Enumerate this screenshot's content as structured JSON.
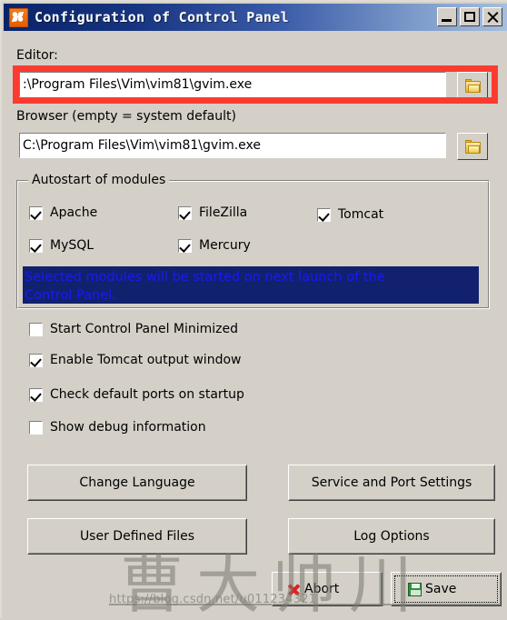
{
  "window": {
    "title": "Configuration of Control Panel",
    "icon": "xampp-icon",
    "controls": {
      "minimize": "minimize-icon",
      "maximize": "maximize-icon",
      "close": "close-icon"
    }
  },
  "editor": {
    "label": "Editor:",
    "value": ":\\Program Files\\Vim\\vim81\\gvim.exe",
    "placeholder": "",
    "browse_icon": "folder-icon",
    "highlight_color": "#fb3b30"
  },
  "browser": {
    "label": "Browser (empty = system default)",
    "value": "C:\\Program Files\\Vim\\vim81\\gvim.exe",
    "placeholder": "",
    "browse_icon": "folder-icon"
  },
  "autostart": {
    "title": "Autostart of modules",
    "modules": [
      {
        "label": "Apache",
        "checked": true
      },
      {
        "label": "FileZilla",
        "checked": true
      },
      {
        "label": "Tomcat",
        "checked": true
      },
      {
        "label": "MySQL",
        "checked": true
      },
      {
        "label": "Mercury",
        "checked": true
      }
    ],
    "info_line1": "Selected modules will be started on next launch of the",
    "info_line2": "Control Panel.",
    "info_bg": "#12216e",
    "info_fg": "#1a1aee"
  },
  "options": [
    {
      "label": "Start Control Panel Minimized",
      "checked": false
    },
    {
      "label": "Enable Tomcat output window",
      "checked": true
    },
    {
      "label": "Check default ports on startup",
      "checked": true
    },
    {
      "label": "Show debug information",
      "checked": false
    }
  ],
  "buttons": {
    "change_language": "Change Language",
    "service_port_settings": "Service and Port Settings",
    "user_defined_files": "User Defined Files",
    "log_options": "Log Options",
    "abort": "Abort",
    "save": "Save",
    "abort_icon": "red-x-icon",
    "save_icon": "green-save-icon"
  },
  "watermark": {
    "characters": "曹大帅川",
    "url": "https://blog.csdn.net/u011234321"
  }
}
